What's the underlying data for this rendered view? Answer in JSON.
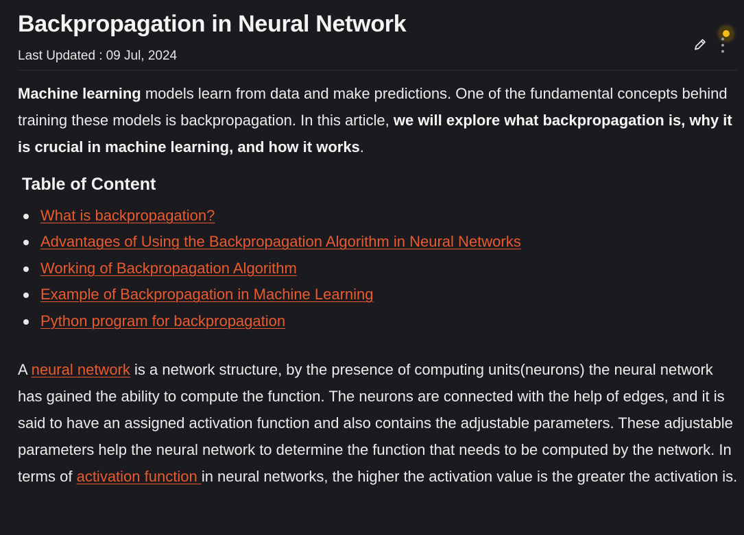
{
  "article": {
    "title": "Backpropagation in Neural Network",
    "updated_label": "Last Updated :",
    "updated_date": "09 Jul, 2024"
  },
  "toolbar": {
    "edit_icon": "pencil-icon",
    "menu_icon": "kebab-menu-icon",
    "notification_color": "#f6bd16"
  },
  "intro": {
    "bold1": "Machine learning",
    "text1": " models learn from data and make predictions. One of the fundamental concepts behind training these models is backpropagation. In this article, ",
    "bold2": "we will explore what backpropagation is, why it is crucial in machine learning, and how it works",
    "text2": "."
  },
  "toc": {
    "title": "Table of Content",
    "items": [
      "What is backpropagation?",
      "Advantages of Using the Backpropagation Algorithm in Neural Networks",
      "Working of Backpropagation Algorithm",
      "Example of Backpropagation in Machine Learning",
      "Python program for backpropagation"
    ]
  },
  "body": {
    "t1": "A ",
    "link1": "neural network",
    "t2": " is a network structure, by the presence of computing units(neurons) the neural network has gained the ability to compute the function. The neurons are connected with the help of edges, and it is said to have an assigned activation function and also contains the adjustable parameters. These adjustable parameters help the neural network to determine the function that needs to be computed by the network. In terms of ",
    "link2": "activation function ",
    "t3": "in neural networks, the higher the activation value is the greater the activation is."
  },
  "colors": {
    "background": "#1a1a1f",
    "text": "#ececec",
    "link": "#ea5a2e"
  }
}
